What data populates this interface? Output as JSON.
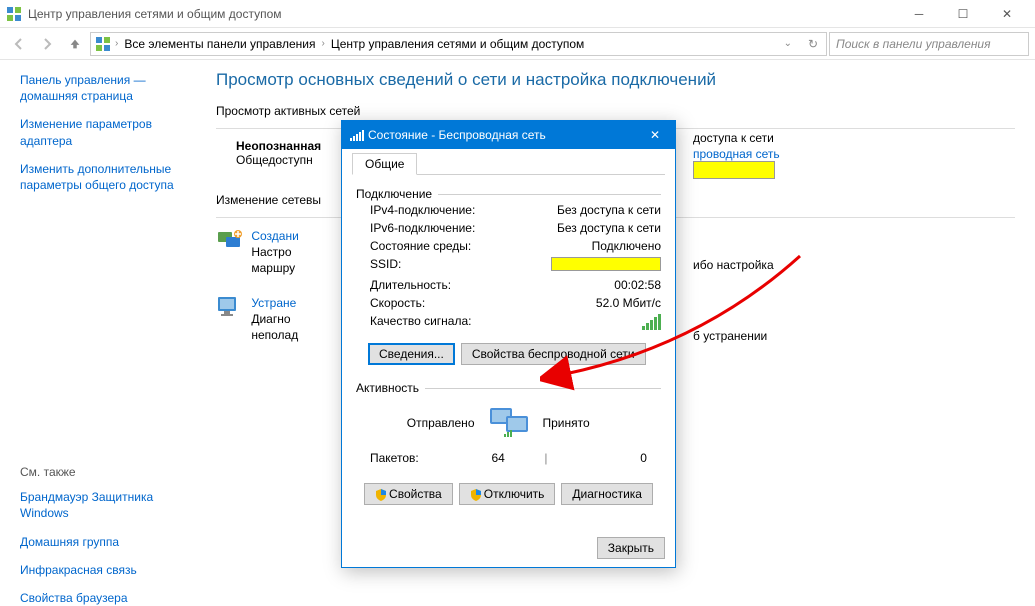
{
  "outer": {
    "title": "Центр управления сетями и общим доступом",
    "min_tip": "Свернуть",
    "max_tip": "Развернуть",
    "close_tip": "Закрыть"
  },
  "nav": {
    "crumb1": "Все элементы панели управления",
    "crumb2": "Центр управления сетями и общим доступом",
    "search_placeholder": "Поиск в панели управления"
  },
  "sidebar": {
    "home": "Панель управления — домашняя страница",
    "adapter": "Изменение параметров адаптера",
    "sharing": "Изменить дополнительные параметры общего доступа",
    "see_also": "См. также",
    "firewall": "Брандмауэр Защитника Windows",
    "homegroup": "Домашняя группа",
    "irda": "Инфракрасная связь",
    "inetopt": "Свойства браузера"
  },
  "main": {
    "heading": "Просмотр основных сведений о сети и настройка подключений",
    "active_net_label": "Просмотр активных сетей",
    "unknown_net": "Неопознанная",
    "public_net": "Общедоступн",
    "access_label": "доступа к сети",
    "wireless_link": "проводная сеть",
    "change_net_label": "Изменение сетевы",
    "task1_title": "Создани",
    "task1_desc1": "Настро",
    "task1_desc2": "маршру",
    "task2_title": "Устране",
    "task2_desc1": "Диагно",
    "task2_desc2": "неполад",
    "task_suffix1": "ибо настройка",
    "task_suffix2": "б устранении"
  },
  "dialog": {
    "title": "Состояние - Беспроводная сеть",
    "tab_general": "Общие",
    "grp_connection": "Подключение",
    "ipv4_label": "IPv4-подключение:",
    "ipv4_value": "Без доступа к сети",
    "ipv6_label": "IPv6-подключение:",
    "ipv6_value": "Без доступа к сети",
    "media_label": "Состояние среды:",
    "media_value": "Подключено",
    "ssid_label": "SSID:",
    "duration_label": "Длительность:",
    "duration_value": "00:02:58",
    "speed_label": "Скорость:",
    "speed_value": "52.0 Мбит/с",
    "signal_label": "Качество сигнала:",
    "details_btn": "Сведения...",
    "wprops_btn": "Свойства беспроводной сети",
    "grp_activity": "Активность",
    "sent_label": "Отправлено",
    "recv_label": "Принято",
    "packets_label": "Пакетов:",
    "sent_value": "64",
    "recv_value": "0",
    "props_btn": "Свойства",
    "disable_btn": "Отключить",
    "diag_btn": "Диагностика",
    "close_btn": "Закрыть"
  }
}
